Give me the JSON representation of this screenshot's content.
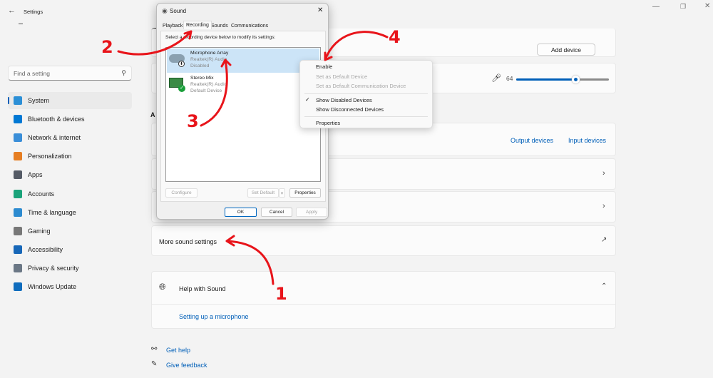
{
  "app": {
    "title": "Settings"
  },
  "search": {
    "placeholder": "Find a setting"
  },
  "sidebar": {
    "items": [
      {
        "label": "System",
        "color": "#2b8fd6",
        "selected": true
      },
      {
        "label": "Bluetooth & devices",
        "color": "#0078d4"
      },
      {
        "label": "Network & internet",
        "color": "#3a8ed8"
      },
      {
        "label": "Personalization",
        "color": "#e67e22"
      },
      {
        "label": "Apps",
        "color": "#555b66"
      },
      {
        "label": "Accounts",
        "color": "#1aa37a"
      },
      {
        "label": "Time & language",
        "color": "#2d8bd0"
      },
      {
        "label": "Gaming",
        "color": "#777"
      },
      {
        "label": "Accessibility",
        "color": "#1767b8"
      },
      {
        "label": "Privacy & security",
        "color": "#6b7785"
      },
      {
        "label": "Windows Update",
        "color": "#0f6cbd"
      }
    ]
  },
  "main": {
    "heading_partial": "S",
    "section_partial": "A",
    "add_device": "Add device",
    "volume": {
      "value": "64",
      "percent": 64
    },
    "output_devices": "Output devices",
    "input_devices": "Input devices",
    "more_sound": "More sound settings",
    "help": "Help with Sound",
    "help_link": "Setting up a microphone",
    "get_help": "Get help",
    "give_feedback": "Give feedback"
  },
  "dialog": {
    "title": "Sound",
    "tabs": [
      "Playback",
      "Recording",
      "Sounds",
      "Communications"
    ],
    "active_tab": "Recording",
    "instruction": "Select a recording device below to modify its settings:",
    "devices": [
      {
        "name": "Microphone Array",
        "driver": "Realtek(R) Audio",
        "status": "Disabled"
      },
      {
        "name": "Stereo Mix",
        "driver": "Realtek(R) Audio",
        "status": "Default Device"
      }
    ],
    "configure": "Configure",
    "set_default": "Set Default",
    "properties": "Properties",
    "ok": "OK",
    "cancel": "Cancel",
    "apply": "Apply"
  },
  "context_menu": {
    "items": [
      {
        "label": "Enable",
        "enabled": true
      },
      {
        "label": "Set as Default Device",
        "enabled": false
      },
      {
        "label": "Set as Default Communication Device",
        "enabled": false
      },
      {
        "label": "Show Disabled Devices",
        "checked": true
      },
      {
        "label": "Show Disconnected Devices"
      },
      {
        "label": "Properties"
      }
    ]
  },
  "annotations": [
    "1",
    "2",
    "3",
    "4"
  ],
  "colors": {
    "accent": "#005fb8",
    "annotation": "#e8141a"
  }
}
